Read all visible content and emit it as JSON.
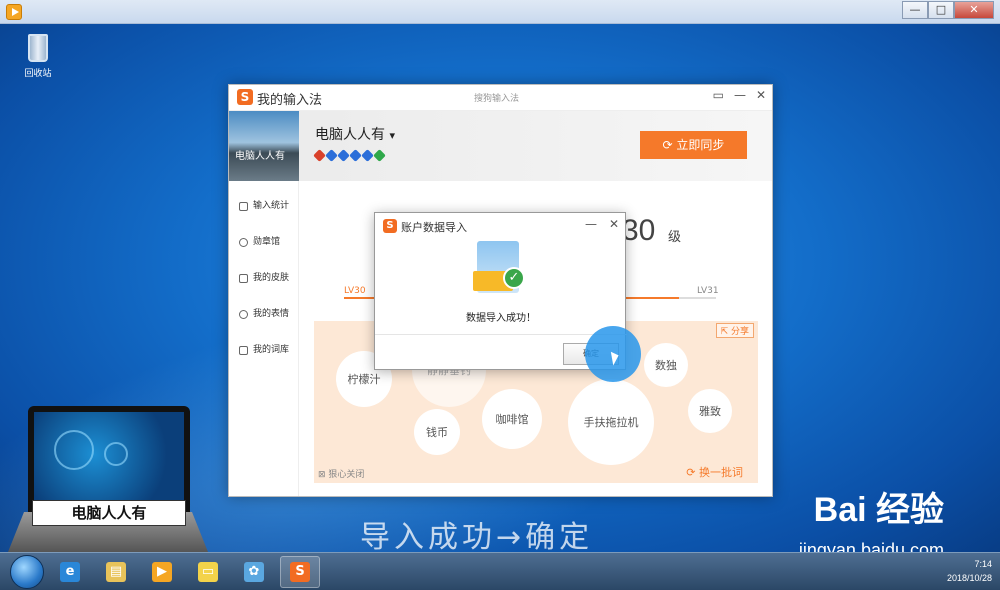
{
  "outer_window": {
    "controls": [
      "—",
      "□",
      "✕"
    ]
  },
  "desktop": {
    "recycle_bin_label": "回收站",
    "laptop_label": "电脑人人有",
    "caption": "导入成功→确定",
    "watermark_brand": "Bai  经验",
    "watermark_url": "jingyan.baidu.com"
  },
  "app": {
    "logo_letter": "S",
    "title": "我的输入法",
    "subtitle": "搜狗输入法",
    "controls": [
      "▭",
      "—",
      "✕"
    ],
    "profile": {
      "image_text": "电脑人人有",
      "name": "电脑人人有",
      "dropdown_glyph": "▾",
      "sync_button": "立即同步",
      "pen_colors": [
        "#d9412b",
        "#2b6ed9",
        "#2b6ed9",
        "#2b6ed9",
        "#2b6ed9",
        "#2fa84a"
      ]
    },
    "sidebar": [
      {
        "label": "输入统计"
      },
      {
        "label": "勋章馆"
      },
      {
        "label": "我的皮肤"
      },
      {
        "label": "我的表情"
      },
      {
        "label": "我的词库"
      }
    ],
    "level": {
      "number": "30",
      "unit": "级",
      "left_label": "LV30",
      "right_label": "LV31",
      "progress": 0.9
    },
    "cloud": {
      "share": "分享",
      "words": [
        "柠檬汁",
        "静静垂钓",
        "钱币",
        "咖啡馆",
        "手扶拖拉机",
        "数独",
        "雅致"
      ],
      "footer_left": "狠心关闭",
      "footer_right": "换一批词"
    }
  },
  "dialog": {
    "logo_letter": "S",
    "title": "账户数据导入",
    "controls": [
      "—",
      "✕"
    ],
    "message": "数据导入成功！",
    "ok_button": "确定"
  },
  "taskbar": {
    "clock_time": "7:14",
    "clock_date": "2018/10/28",
    "apps": [
      {
        "name": "ie",
        "color": "#2a87d8",
        "glyph": "e"
      },
      {
        "name": "explorer",
        "color": "#e8c35a",
        "glyph": "▤"
      },
      {
        "name": "media",
        "color": "#f5a623",
        "glyph": "▶"
      },
      {
        "name": "sticky",
        "color": "#f3d34a",
        "glyph": "▭"
      },
      {
        "name": "paint",
        "color": "#5aa7e0",
        "glyph": "✿"
      },
      {
        "name": "sogou",
        "color": "#f26c22",
        "glyph": "S"
      }
    ]
  }
}
